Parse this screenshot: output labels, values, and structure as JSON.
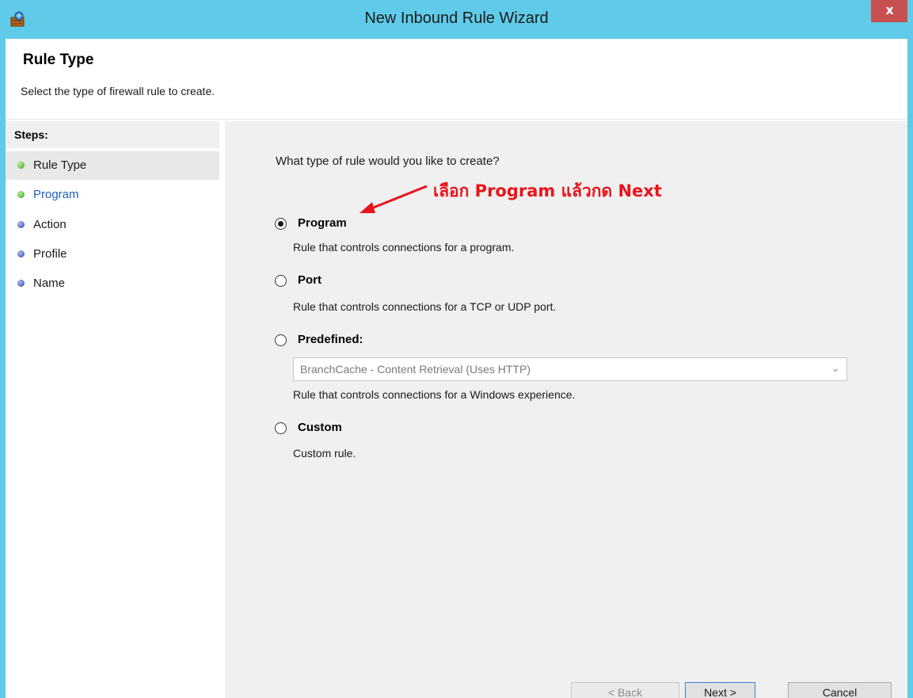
{
  "window": {
    "title": "New Inbound Rule Wizard",
    "close_glyph": "x",
    "app_icon": "firewall-icon"
  },
  "header": {
    "title": "Rule Type",
    "subtitle": "Select the type of firewall rule to create."
  },
  "steps": {
    "heading": "Steps:",
    "items": [
      {
        "label": "Rule Type",
        "status": "done",
        "color": "#4caf30"
      },
      {
        "label": "Program",
        "status": "done",
        "color": "#4caf30"
      },
      {
        "label": "Action",
        "status": "pending",
        "color": "#3f51b5"
      },
      {
        "label": "Profile",
        "status": "pending",
        "color": "#3f51b5"
      },
      {
        "label": "Name",
        "status": "pending",
        "color": "#3f51b5"
      }
    ]
  },
  "main": {
    "question": "What type of rule would you like to create?",
    "annotation": "เลือก Program แล้วกด Next",
    "annotation_color": "#e8141b",
    "options": [
      {
        "label": "Program",
        "desc": "Rule that controls connections for a program.",
        "selected": true
      },
      {
        "label": "Port",
        "desc": "Rule that controls connections for a TCP or UDP port.",
        "selected": false
      },
      {
        "label": "Predefined:",
        "desc": "Rule that controls connections for a Windows experience.",
        "selected": false,
        "dropdown_value": "BranchCache - Content Retrieval (Uses HTTP)"
      },
      {
        "label": "Custom",
        "desc": "Custom rule.",
        "selected": false
      }
    ]
  },
  "buttons": {
    "back": "< Back",
    "next": "Next >",
    "cancel": "Cancel"
  }
}
